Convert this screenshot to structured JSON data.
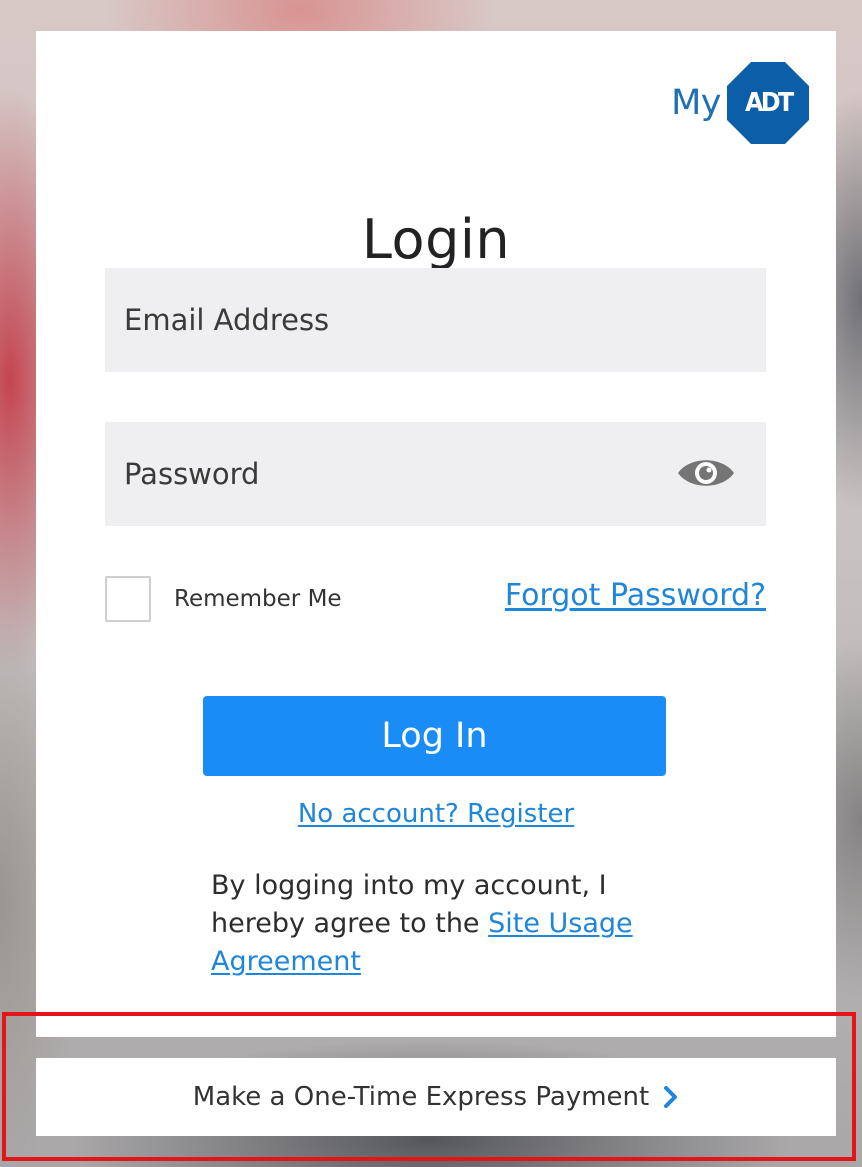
{
  "logo": {
    "my_text": "My",
    "badge_text": "ADT"
  },
  "login": {
    "title": "Login",
    "email_placeholder": "Email Address",
    "password_placeholder": "Password",
    "remember_label": "Remember Me",
    "forgot_link": "Forgot Password?",
    "submit_label": "Log In",
    "register_link": "No account? Register",
    "agreement_prefix": "By logging into my account, I hereby agree to the ",
    "agreement_link": "Site Usage Agreement"
  },
  "footer": {
    "express_payment_label": "Make a One-Time Express Payment"
  },
  "icons": {
    "eye": "eye-icon",
    "chevron": "chevron-right-icon"
  },
  "colors": {
    "brand_blue": "#0b5fa8",
    "button_blue": "#1a8cf6",
    "link_blue": "#1f86d9",
    "highlight_red": "#e3151a"
  }
}
